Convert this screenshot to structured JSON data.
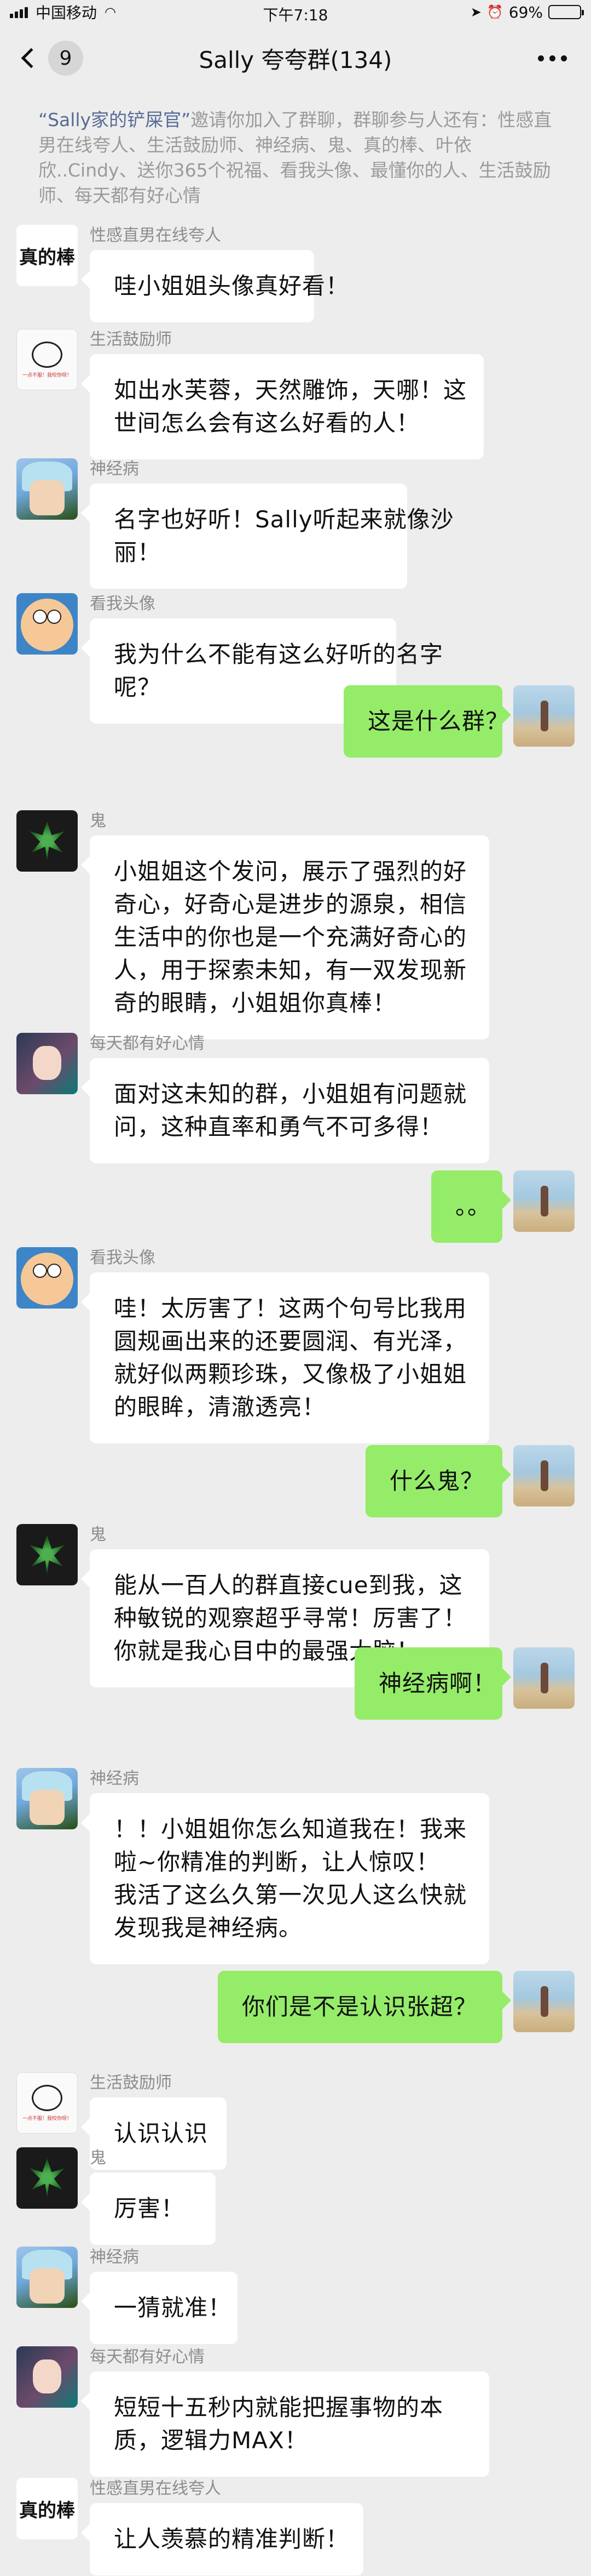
{
  "status_bar": {
    "carrier": "中国移动",
    "time": "下午7:18",
    "battery": "69%",
    "battery_level": 0.69
  },
  "header": {
    "back_count": "9",
    "title": "Sally 夸夸群(134)"
  },
  "system_notice": {
    "inviter": "“Sally家的铲屎官”",
    "text": "邀请你加入了群聊，群聊参与人还有：性感直男在线夸人、生活鼓励师、神经病、鬼、真的棒、叶依欣..Cindy、送你365个祝福、看我头像、最懂你的人、生活鼓励师、每天都有好心情"
  },
  "messages": [
    {
      "side": "left",
      "sender": "性感直男在线夸人",
      "avatar": "zhen",
      "avatar_text": "真的棒",
      "lines": [
        "哇小姐姐头像真好看！"
      ]
    },
    {
      "side": "left",
      "sender": "生活鼓励师",
      "avatar": "life",
      "avatar_text": "一点不服！我咬你呀！",
      "lines": [
        "如出水芙蓉，天然雕饰，天哪！这",
        "世间怎么会有这么好看的人！"
      ]
    },
    {
      "side": "left",
      "sender": "神经病",
      "avatar": "rick",
      "lines": [
        "名字也好听！Sally听起来就像沙",
        "丽！"
      ]
    },
    {
      "side": "left",
      "sender": "看我头像",
      "avatar": "cart",
      "lines": [
        "我为什么不能有这么好听的名字",
        "呢？"
      ]
    },
    {
      "side": "right",
      "avatar": "beach",
      "lines": [
        "这是什么群？"
      ]
    },
    {
      "side": "left",
      "sender": "鬼",
      "avatar": "leaf",
      "lines": [
        "小姐姐这个发问，展示了强烈的好",
        "奇心，好奇心是进步的源泉，相信",
        "生活中的你也是一个充满好奇心的",
        "人，用于探索未知，有一双发现新",
        "奇的眼睛，小姐姐你真棒！"
      ]
    },
    {
      "side": "left",
      "sender": "每天都有好心情",
      "avatar": "girl",
      "lines": [
        "面对这未知的群，小姐姐有问题就",
        "问，这种直率和勇气不可多得！"
      ]
    },
    {
      "side": "right",
      "avatar": "beach",
      "lines": [
        "。。"
      ]
    },
    {
      "side": "left",
      "sender": "看我头像",
      "avatar": "cart",
      "lines": [
        "哇！太厉害了！这两个句号比我用",
        "圆规画出来的还要圆润、有光泽，",
        "就好似两颗珍珠，又像极了小姐姐",
        "的眼眸，清澈透亮！"
      ]
    },
    {
      "side": "right",
      "avatar": "beach",
      "lines": [
        "什么鬼？"
      ]
    },
    {
      "side": "left",
      "sender": "鬼",
      "avatar": "leaf",
      "lines": [
        "能从一百人的群直接cue到我，这",
        "种敏锐的观察超乎寻常！厉害了！",
        "你就是我心目中的最强大脑！"
      ]
    },
    {
      "side": "right",
      "avatar": "beach",
      "lines": [
        "神经病啊！"
      ]
    },
    {
      "side": "left",
      "sender": "神经病",
      "avatar": "rick",
      "lines": [
        "！！小姐姐你怎么知道我在！我来",
        "啦~你精准的判断，让人惊叹！",
        "我活了这么久第一次见人这么快就",
        "发现我是神经病。"
      ]
    },
    {
      "side": "right",
      "avatar": "beach",
      "lines": [
        "你们是不是认识张超？"
      ]
    },
    {
      "side": "left",
      "sender": "生活鼓励师",
      "avatar": "life",
      "avatar_text": "一点不服！我咬你呀！",
      "lines": [
        "认识认识"
      ]
    },
    {
      "side": "left",
      "sender": "鬼",
      "avatar": "leaf",
      "lines": [
        "厉害！"
      ]
    },
    {
      "side": "left",
      "sender": "神经病",
      "avatar": "rick",
      "lines": [
        "一猜就准！"
      ]
    },
    {
      "side": "left",
      "sender": "每天都有好心情",
      "avatar": "girl",
      "lines": [
        "短短十五秒内就能把握事物的本",
        "质，逻辑力MAX！"
      ]
    },
    {
      "side": "left",
      "sender": "性感直男在线夸人",
      "avatar": "zhen",
      "avatar_text": "真的棒",
      "lines": [
        "让人羡慕的精准判断！"
      ]
    }
  ],
  "colors": {
    "background": "#ededed",
    "bubble_self": "#95ec69",
    "bubble_other": "#ffffff",
    "link": "#576b95"
  }
}
